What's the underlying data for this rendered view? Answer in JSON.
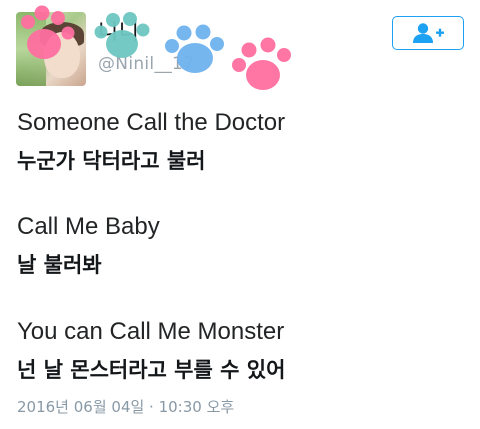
{
  "profile": {
    "display_name": "니니",
    "handle": "@Ninil__17"
  },
  "follow_button": {
    "icon": "add-user-icon",
    "color": "#1da1f2"
  },
  "tweet": {
    "lines": [
      "Someone Call the Doctor",
      "누군가 닥터라고 불러",
      "Call Me Baby",
      "날 불러봐",
      "You can Call Me Monster",
      "넌 날 몬스터라고 부를 수 있어"
    ],
    "timestamp": "2016년 06월 04일 · 10:30 오후"
  },
  "stickers": {
    "paw_colors": [
      "#ff6fa0",
      "#6ec7c1",
      "#6fb3ef",
      "#ff6fa0"
    ]
  }
}
